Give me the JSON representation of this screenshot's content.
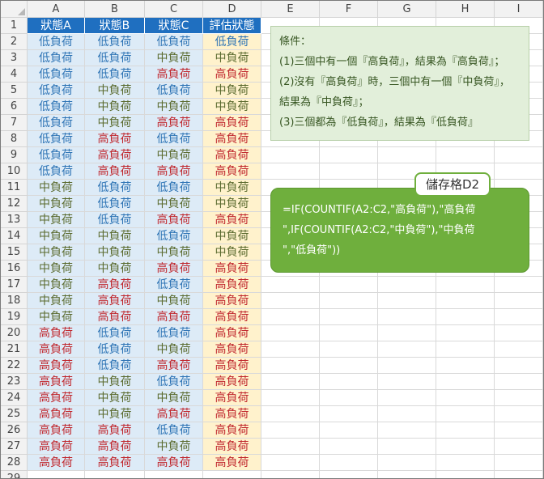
{
  "columns": [
    "A",
    "B",
    "C",
    "D",
    "E",
    "F",
    "G",
    "H",
    "I"
  ],
  "headers": [
    "狀態A",
    "狀態B",
    "狀態C",
    "評估狀態"
  ],
  "rows": [
    [
      "低負荷",
      "低負荷",
      "低負荷",
      "低負荷"
    ],
    [
      "低負荷",
      "低負荷",
      "中負荷",
      "中負荷"
    ],
    [
      "低負荷",
      "低負荷",
      "高負荷",
      "高負荷"
    ],
    [
      "低負荷",
      "中負荷",
      "低負荷",
      "中負荷"
    ],
    [
      "低負荷",
      "中負荷",
      "中負荷",
      "中負荷"
    ],
    [
      "低負荷",
      "中負荷",
      "高負荷",
      "高負荷"
    ],
    [
      "低負荷",
      "高負荷",
      "低負荷",
      "高負荷"
    ],
    [
      "低負荷",
      "高負荷",
      "中負荷",
      "高負荷"
    ],
    [
      "低負荷",
      "高負荷",
      "高負荷",
      "高負荷"
    ],
    [
      "中負荷",
      "低負荷",
      "低負荷",
      "中負荷"
    ],
    [
      "中負荷",
      "低負荷",
      "中負荷",
      "中負荷"
    ],
    [
      "中負荷",
      "低負荷",
      "高負荷",
      "高負荷"
    ],
    [
      "中負荷",
      "中負荷",
      "低負荷",
      "中負荷"
    ],
    [
      "中負荷",
      "中負荷",
      "中負荷",
      "中負荷"
    ],
    [
      "中負荷",
      "中負荷",
      "高負荷",
      "高負荷"
    ],
    [
      "中負荷",
      "高負荷",
      "低負荷",
      "高負荷"
    ],
    [
      "中負荷",
      "高負荷",
      "中負荷",
      "高負荷"
    ],
    [
      "中負荷",
      "高負荷",
      "高負荷",
      "高負荷"
    ],
    [
      "高負荷",
      "低負荷",
      "低負荷",
      "高負荷"
    ],
    [
      "高負荷",
      "低負荷",
      "中負荷",
      "高負荷"
    ],
    [
      "高負荷",
      "低負荷",
      "高負荷",
      "高負荷"
    ],
    [
      "高負荷",
      "中負荷",
      "低負荷",
      "高負荷"
    ],
    [
      "高負荷",
      "中負荷",
      "中負荷",
      "高負荷"
    ],
    [
      "高負荷",
      "中負荷",
      "高負荷",
      "高負荷"
    ],
    [
      "高負荷",
      "高負荷",
      "低負荷",
      "高負荷"
    ],
    [
      "高負荷",
      "高負荷",
      "中負荷",
      "高負荷"
    ],
    [
      "高負荷",
      "高負荷",
      "高負荷",
      "高負荷"
    ]
  ],
  "last_row_number": "29",
  "note": {
    "lines": [
      "條件：",
      "(1)三個中有一個『高負荷』，結果為『高負荷』；",
      "(2)沒有『高負荷』時，三個中有一個『中負荷』，",
      "結果為『中負荷』；",
      "(3)三個都為『低負荷』，結果為『低負荷』"
    ]
  },
  "formula": {
    "label": "儲存格D2",
    "lines": [
      "=IF(COUNTIF(A2:C2,\"高負荷\"),\"高負荷",
      "\",IF(COUNTIF(A2:C2,\"中負荷\"),\"中負荷",
      "\",\"低負荷\"))"
    ]
  },
  "colors": {
    "header_bg": "#1f6fc0",
    "low": "#2e74b5",
    "mid": "#5b6b2f",
    "high": "#c0272d",
    "data_bg": "#ddebf7",
    "result_bg": "#fff2cc",
    "note_bg": "#e2efda",
    "formula_bg": "#6faf3d"
  }
}
